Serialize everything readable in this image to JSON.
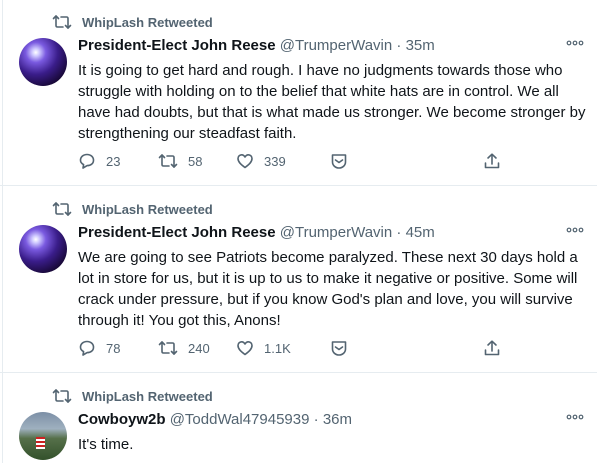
{
  "tweets": [
    {
      "retweeted_by": "WhipLash Retweeted",
      "name": "President-Elect John Reese",
      "handle": "@TrumperWavin",
      "time": "35m",
      "text": "It is going to get hard and rough. I have no judgments towards those who struggle with holding on to the belief that white hats are in control. We all have had doubts, but that is what made us stronger. We become stronger by strengthening our steadfast faith.",
      "replies": "23",
      "retweets": "58",
      "likes": "339"
    },
    {
      "retweeted_by": "WhipLash Retweeted",
      "name": "President-Elect John Reese",
      "handle": "@TrumperWavin",
      "time": "45m",
      "text": "We are going to see Patriots become paralyzed. These next 30 days hold a lot in store for us, but it is up to us to make it negative or positive. Some will crack under pressure, but if you know God's plan and love, you will survive through it! You got this, Anons!",
      "replies": "78",
      "retweets": "240",
      "likes": "1.1K"
    },
    {
      "retweeted_by": "WhipLash Retweeted",
      "name": "Cowboyw2b",
      "handle": "@ToddWal47945939",
      "time": "36m",
      "text": "It's time."
    }
  ],
  "separator": " · ",
  "colors": {
    "text": "#0f1419",
    "secondary": "#536471",
    "divider": "#e6ecf0"
  },
  "icons": [
    "retweet-icon",
    "more-icon",
    "reply-icon",
    "like-icon",
    "dm-icon",
    "share-icon"
  ]
}
